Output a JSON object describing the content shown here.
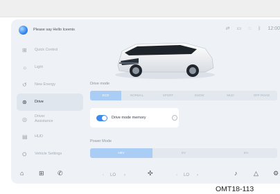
{
  "voice": {
    "prompt": "Please say Hello Iceenis"
  },
  "status": {
    "time": "12:00"
  },
  "sidebar": {
    "items": [
      {
        "label": "Quick Control",
        "icon": "quick-control-icon"
      },
      {
        "label": "Light",
        "icon": "light-icon"
      },
      {
        "label": "New Energy",
        "icon": "new-energy-icon"
      },
      {
        "label": "Drive",
        "icon": "drive-icon"
      },
      {
        "label": "Driver Assistance",
        "icon": "driver-assistance-icon"
      },
      {
        "label": "HUD",
        "icon": "hud-icon"
      },
      {
        "label": "Vehicle Settings",
        "icon": "vehicle-settings-icon"
      }
    ],
    "active": "Drive"
  },
  "drive_mode": {
    "title": "Drive mode",
    "options": [
      "ECO",
      "NORMAL",
      "SPORT",
      "SNOW",
      "MUD",
      "OFF-ROAD"
    ],
    "selected": "ECO"
  },
  "memory": {
    "label": "Drive mode memory",
    "enabled": true
  },
  "power_mode": {
    "title": "Power Mode",
    "options": [
      "HEV",
      "EV",
      "EH"
    ],
    "selected": "HEV"
  },
  "dock": {
    "left_temp": "LO",
    "right_temp": "LO"
  },
  "footer": {
    "code": "OMT18-113"
  },
  "colors": {
    "accent": "#3f8ce8",
    "selected_segment": "#a9cdf4",
    "screen_bg": "#eef2f6"
  }
}
